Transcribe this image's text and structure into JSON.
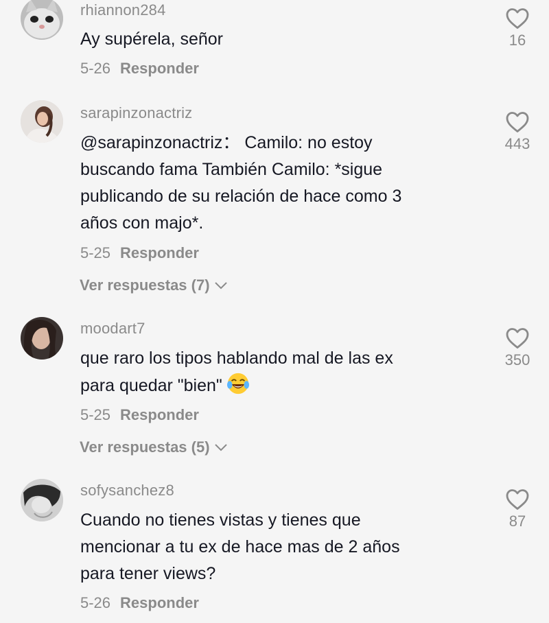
{
  "comments": [
    {
      "username": "rhiannon284",
      "text": "Ay supérela, señor",
      "date": "5-26",
      "reply_label": "Responder",
      "likes": "16",
      "avatar_icon": "cat-face-avatar"
    },
    {
      "username": "sarapinzonactriz",
      "text_lines": [
        "@sarapinzonactriz：  Camilo: no estoy",
        "buscando fama También Camilo: *sigue",
        "publicando de su relación de hace como 3",
        "años con majo*."
      ],
      "date": "5-25",
      "reply_label": "Responder",
      "likes": "443",
      "view_replies": "Ver respuestas (7)",
      "avatar_icon": "woman-photo-avatar"
    },
    {
      "username": "moodart7",
      "text_lines": [
        "que raro los tipos hablando mal de las ex",
        "para quedar \"bien\""
      ],
      "emoji": "face-with-tears-of-joy",
      "date": "5-25",
      "reply_label": "Responder",
      "likes": "350",
      "view_replies": "Ver respuestas (5)",
      "avatar_icon": "woman-dark-hair-avatar"
    },
    {
      "username": "sofysanchez8",
      "text_lines": [
        "Cuando no tienes vistas y tienes que",
        "mencionar a tu ex de hace mas de 2 años",
        "para tener views?"
      ],
      "date": "5-26",
      "reply_label": "Responder",
      "likes": "87",
      "avatar_icon": "woman-bw-avatar"
    }
  ],
  "colors": {
    "background": "#f5f5f5",
    "text": "#161823",
    "secondary": "#8a8a8a"
  }
}
